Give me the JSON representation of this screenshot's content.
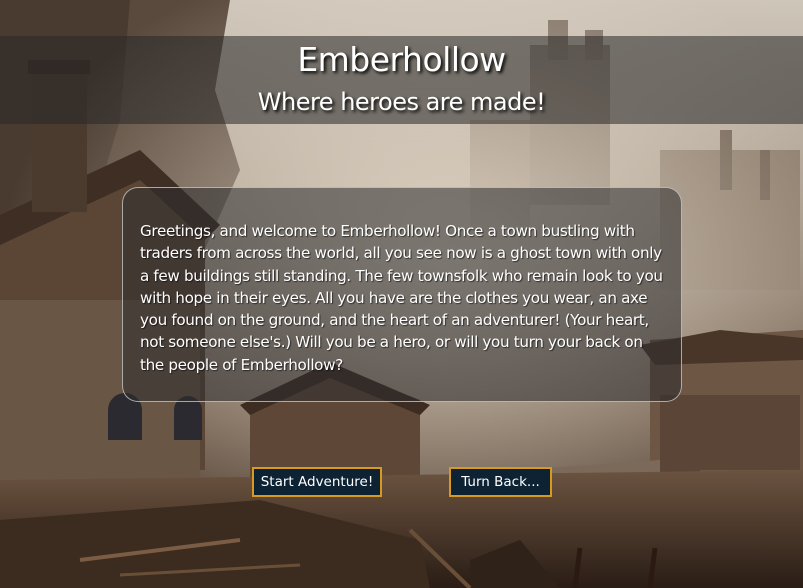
{
  "header": {
    "title": "Emberhollow",
    "subtitle": "Where heroes are made!"
  },
  "dialog": {
    "text": "Greetings, and welcome to Emberhollow! Once a town bustling with traders from across the world, all you see now is a ghost town with only a few buildings still standing. The few townsfolk who remain look to you with hope in their eyes. All you have are the clothes you wear, an axe you found on the ground, and the heart of an adventurer! (Your heart, not someone else's.) Will you be a hero, or will you turn your back on the people of Emberhollow?"
  },
  "actions": {
    "start_label": "Start Adventure!",
    "back_label": "Turn Back..."
  },
  "colors": {
    "button_bg": "#0d2334",
    "button_border": "#d59a1f",
    "banner_bg": "rgba(40,40,40,0.55)"
  }
}
